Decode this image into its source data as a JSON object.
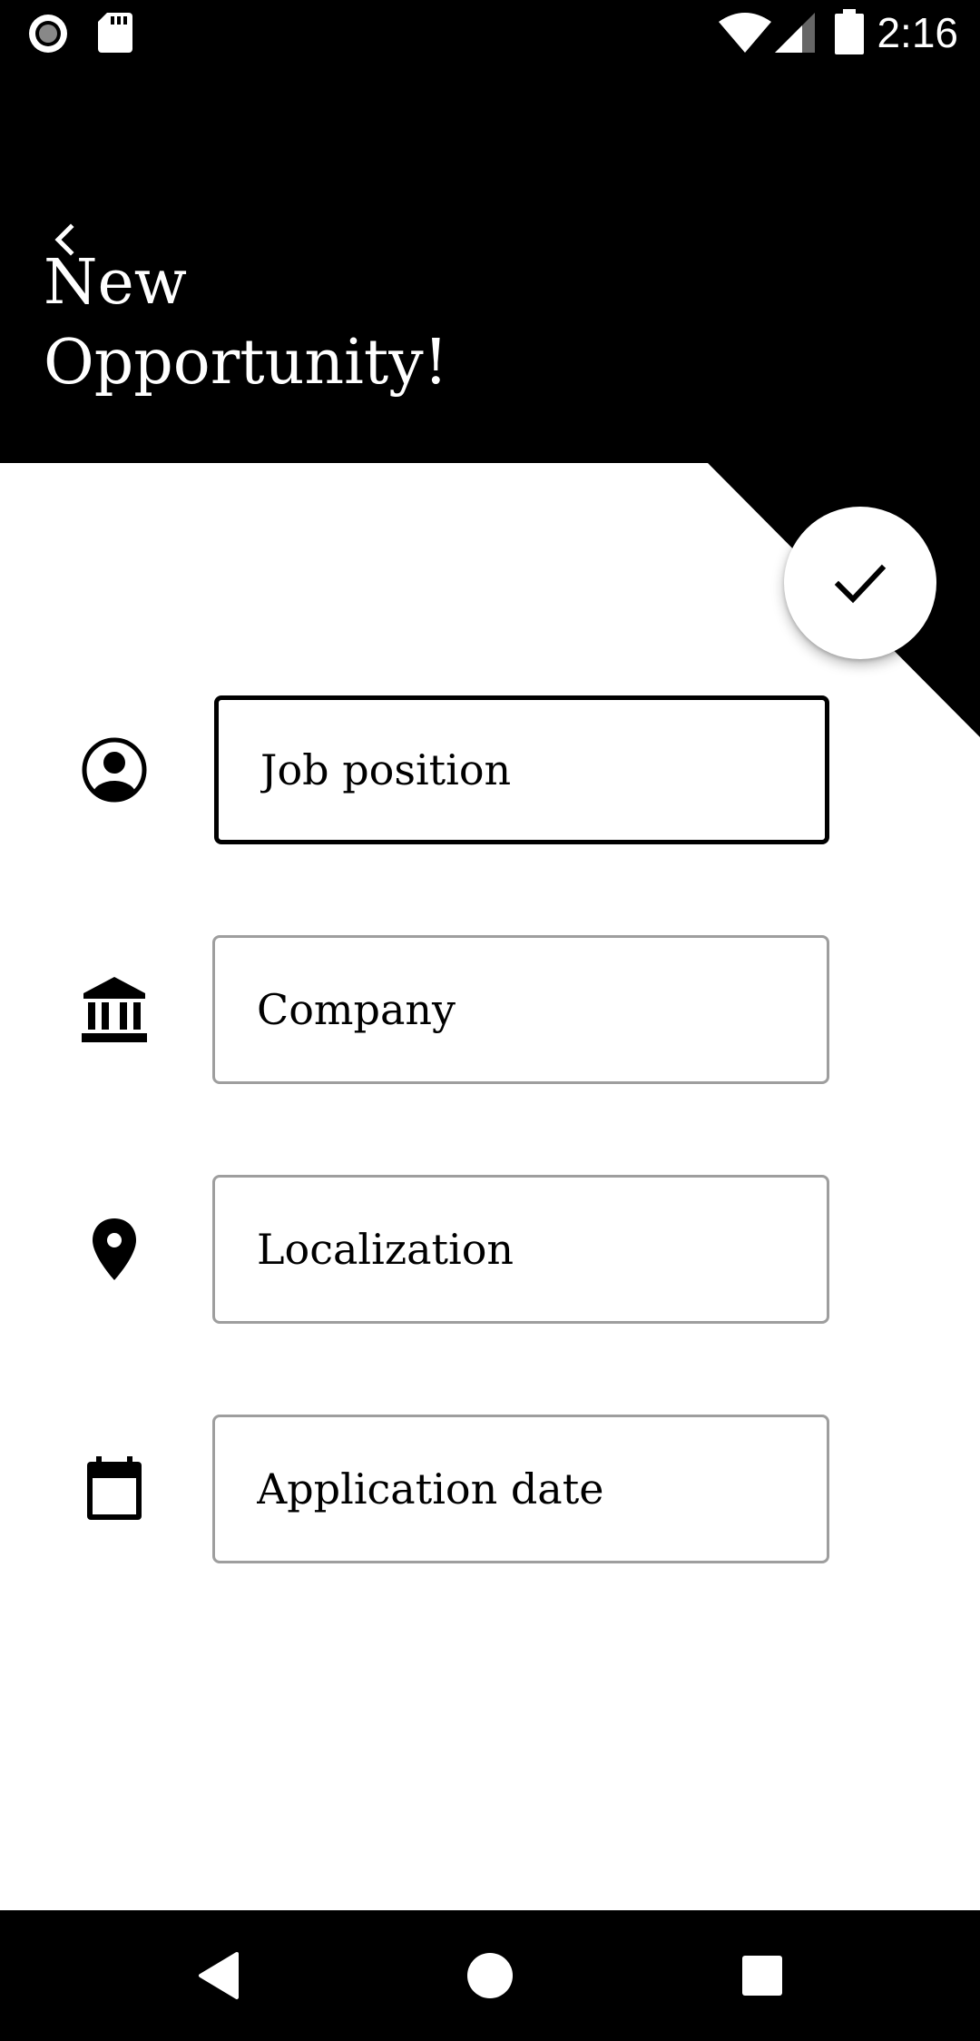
{
  "status_bar": {
    "time": "2:16",
    "left_icons": [
      "record-icon",
      "sd-card-icon"
    ],
    "right_icons": [
      "wifi-icon",
      "cell-signal-icon",
      "battery-icon"
    ]
  },
  "header": {
    "back_icon": "chevron-left-icon",
    "title_line1": "New",
    "title_line2": "Opportunity!"
  },
  "fab": {
    "icon": "check-icon"
  },
  "form": {
    "fields": [
      {
        "icon": "account-circle-icon",
        "placeholder": "Job position",
        "value": "",
        "focused": true
      },
      {
        "icon": "bank-icon",
        "placeholder": "Company",
        "value": ""
      },
      {
        "icon": "location-pin-icon",
        "placeholder": "Localization",
        "value": ""
      },
      {
        "icon": "calendar-icon",
        "placeholder": "Application date",
        "value": ""
      }
    ]
  },
  "nav_bar": {
    "buttons": [
      "back-triangle-icon",
      "home-circle-icon",
      "recents-square-icon"
    ]
  },
  "colors": {
    "primary": "#000000",
    "background": "#ffffff",
    "field_border": "#9e9e9e"
  }
}
